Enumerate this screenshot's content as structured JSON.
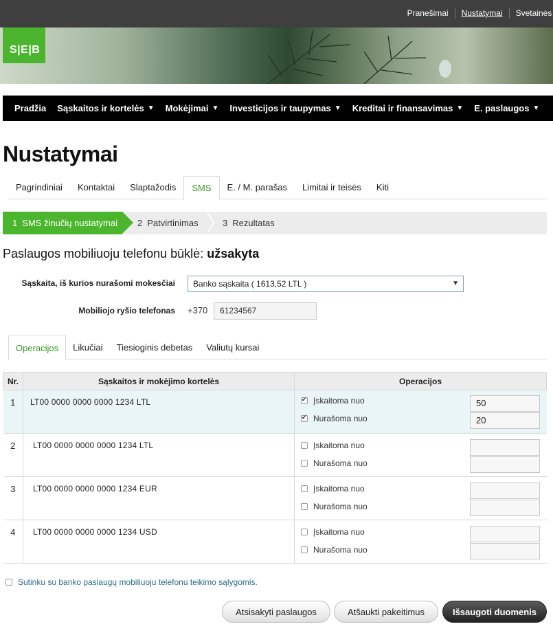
{
  "topbar": {
    "links": [
      "Pranešimai",
      "Nustatymai",
      "Svetainės st"
    ],
    "active_index": 1
  },
  "brand": {
    "logo_text": "S|E|B"
  },
  "mainnav": [
    {
      "label": "Pradžia",
      "has_arrow": false
    },
    {
      "label": "Sąskaitos ir kortelės",
      "has_arrow": true
    },
    {
      "label": "Mokėjimai",
      "has_arrow": true
    },
    {
      "label": "Investicijos ir taupymas",
      "has_arrow": true
    },
    {
      "label": "Kreditai ir finansavimas",
      "has_arrow": true
    },
    {
      "label": "E. paslaugos",
      "has_arrow": true
    }
  ],
  "page_title": "Nustatymai",
  "settings_tabs": [
    "Pagrindiniai",
    "Kontaktai",
    "Slaptažodis",
    "SMS",
    "E. / M. parašas",
    "Limitai ir teisės",
    "Kiti"
  ],
  "settings_tab_active": 3,
  "steps": [
    {
      "num": "1",
      "label": "SMS žinučių nustatymai"
    },
    {
      "num": "2",
      "label": "Patvirtinimas"
    },
    {
      "num": "3",
      "label": "Rezultatas"
    }
  ],
  "status": {
    "label": "Paslaugos mobiliuoju telefonu būklė:",
    "value": "užsakyta"
  },
  "form": {
    "account_label": "Sąskaita, iš kurios nurašomi mokesčiai",
    "account_value": "Banko sąskaita ( 1613,52 LTL )",
    "phone_label": "Mobiliojo ryšio telefonas",
    "phone_prefix": "+370",
    "phone_value": "61234567"
  },
  "inner_tabs": [
    "Operacijos",
    "Likučiai",
    "Tiesioginis debetas",
    "Valiutų kursai"
  ],
  "table": {
    "headers": [
      "Nr.",
      "Sąskaitos ir mokėjimo kortelės",
      "Operacijos"
    ],
    "rows": [
      {
        "nr": "1",
        "account": "LT00 0000 0000 0000 1234 LTL",
        "op1": "Įskaitoma nuo",
        "op1_checked": true,
        "op1_value": "50",
        "op2": "Nurašoma nuo",
        "op2_checked": true,
        "op2_value": "20"
      },
      {
        "nr": "2",
        "account": "LT00 0000 0000 0000 1234 LTL",
        "op1": "Įskaitoma nuo",
        "op1_checked": false,
        "op1_value": "",
        "op2": "Nurašoma nuo",
        "op2_checked": false,
        "op2_value": ""
      },
      {
        "nr": "3",
        "account": "LT00 0000 0000 0000 1234 EUR",
        "op1": "Įskaitoma nuo",
        "op1_checked": false,
        "op1_value": "",
        "op2": "Nurašoma nuo",
        "op2_checked": false,
        "op2_value": ""
      },
      {
        "nr": "4",
        "account": "LT00 0000 0000 0000 1234 USD",
        "op1": "Įskaitoma nuo",
        "op1_checked": false,
        "op1_value": "",
        "op2": "Nurašoma nuo",
        "op2_checked": false,
        "op2_value": ""
      }
    ]
  },
  "agree_text": "Sutinku su banko paslaugų mobiliuoju telefonu teikimo sąlygomis.",
  "buttons": {
    "cancel_service": "Atsisakyti paslaugos",
    "revert": "Atšaukti pakeitimus",
    "save": "Išsaugoti duomenis"
  },
  "colors": {
    "brand_green": "#4bb62d",
    "active_tab": "#3a9a2a",
    "nav_bg": "#000000",
    "link": "#2a6e8c"
  }
}
